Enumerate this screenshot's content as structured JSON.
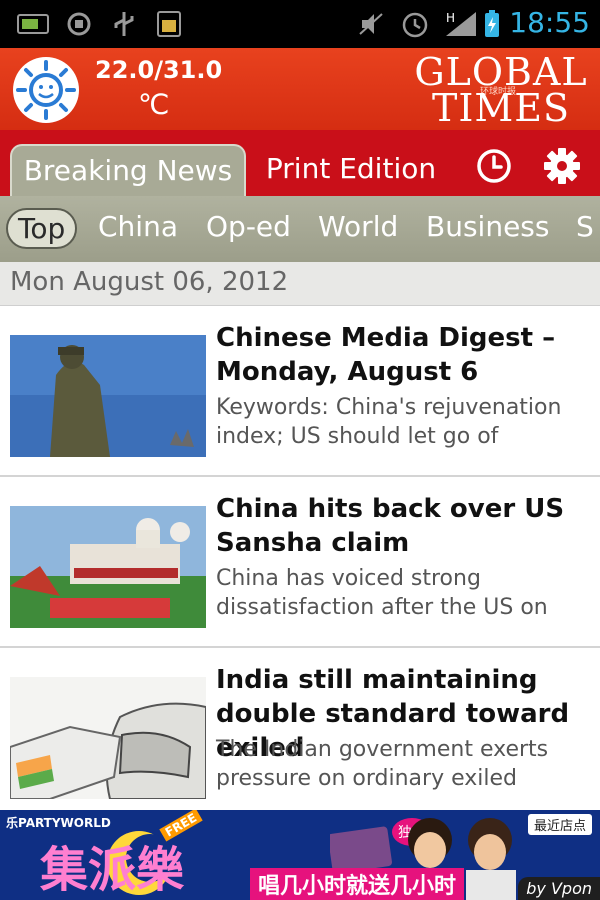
{
  "status_bar": {
    "time": "18:55",
    "icons": [
      "battery-saver-icon",
      "android-debug-icon",
      "usb-icon",
      "sd-card-icon",
      "mute-icon",
      "alarm-icon",
      "signal-h-icon",
      "battery-icon"
    ]
  },
  "header": {
    "temperature": "22.0/31.0",
    "unit": "℃",
    "logo_line1": "GLOBAL",
    "logo_line2": "TIMES",
    "logo_cn": "环球时报",
    "weather_icon": "sunny-weather-icon"
  },
  "tabs": [
    {
      "label": "Breaking News",
      "active": true
    },
    {
      "label": "Print Edition",
      "active": false
    }
  ],
  "tab_actions": [
    "clock-icon",
    "settings-gear-icon"
  ],
  "categories": [
    {
      "label": "Top",
      "active": true
    },
    {
      "label": "China"
    },
    {
      "label": "Op-ed"
    },
    {
      "label": "World"
    },
    {
      "label": "Business"
    },
    {
      "label": "S"
    }
  ],
  "date": "Mon August 06, 2012",
  "articles": [
    {
      "title": "Chinese Media Digest – Monday, August 6",
      "summary": "Keywords: China's rejuvenation index; US should let go of"
    },
    {
      "title": "China hits back over US Sansha claim",
      "summary": "China has voiced strong dissatisfaction after the US on"
    },
    {
      "title": "India still maintaining double standard toward exiled",
      "summary": "The Indian government exerts pressure on ordinary exiled"
    }
  ],
  "ad": {
    "brand": "乐PARTYWORLD",
    "free_badge": "FREE",
    "headline_cn": "集派樂",
    "exclusive_cn": "独享",
    "promo_cn": "唱几小时就送几小时",
    "store_label": "最近店点",
    "by_label": "by Vpon"
  },
  "colors": {
    "header_red": "#e03a1a",
    "tab_red": "#c90f19",
    "tab_active_gray": "#a8aa96",
    "status_time_blue": "#35b5e5"
  }
}
